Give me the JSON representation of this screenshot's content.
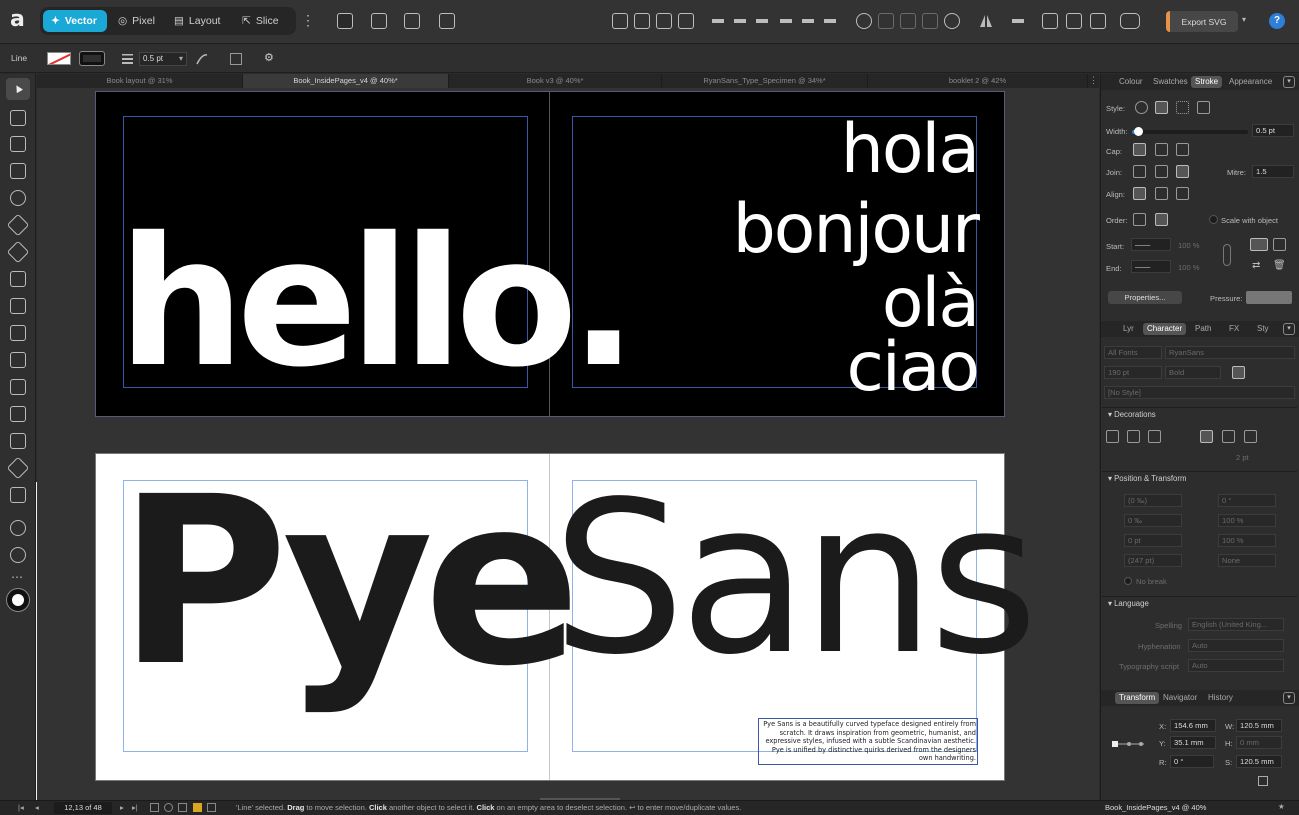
{
  "app": {
    "logo_letter": "a"
  },
  "personas": [
    {
      "label": "Vector",
      "icon": "vector-persona-icon",
      "active": true
    },
    {
      "label": "Pixel",
      "icon": "pixel-persona-icon"
    },
    {
      "label": "Layout",
      "icon": "layout-persona-icon"
    },
    {
      "label": "Slice",
      "icon": "slice-persona-icon"
    }
  ],
  "toolbar": {
    "export_label": "Export SVG",
    "help_label": "?"
  },
  "context": {
    "selection_type": "Line",
    "stroke_width": "0.5 pt"
  },
  "tabs": [
    {
      "label": "Book layout @ 31%"
    },
    {
      "label": "Book_InsidePages_v4 @ 40%*",
      "active": true
    },
    {
      "label": "Book v3 @ 40%*"
    },
    {
      "label": "RyanSans_Type_Specimen @ 34%*"
    },
    {
      "label": "booklet 2 @ 42%"
    }
  ],
  "canvas": {
    "hello_word": "hello.",
    "greetings": [
      "hola",
      "bonjour",
      "olà",
      "ciao"
    ],
    "title_left": "Pye",
    "title_right": "Sans",
    "blurb": "Pye Sans is a beautifully curved typeface designed entirely from scratch. It draws inspiration from geometric, humanist, and expressive styles, infused with a subtle Scandinavian aesthetic. Pye is unified by distinctive quirks derived from the designers own handwriting."
  },
  "stroke_panel": {
    "tabs": [
      "Colour",
      "Swatches",
      "Stroke",
      "Appearance"
    ],
    "style_label": "Style:",
    "width_label": "Width:",
    "width_value": "0.5 pt",
    "width_fraction": 0.05,
    "cap_label": "Cap:",
    "join_label": "Join:",
    "mitre_label": "Mitre:",
    "mitre_value": "1.5",
    "align_label": "Align:",
    "order_label": "Order:",
    "scale_label": "Scale with object",
    "start_label": "Start:",
    "end_label": "End:",
    "start_pct": "100 %",
    "end_pct": "100 %",
    "properties_btn": "Properties...",
    "pressure_label": "Pressure:"
  },
  "character_panel": {
    "tabs": [
      "Lyr",
      "Character",
      "Path",
      "FX",
      "Sty"
    ],
    "font_collection": "All Fonts",
    "font_family": "RyanSans",
    "font_size": "190 pt",
    "font_weight": "Bold",
    "style": "[No Style]",
    "decorations_head": "Decorations",
    "deco_size": "2 pt",
    "position_head": "Position & Transform",
    "pos_values": [
      "(0 ‰)",
      "0 °",
      "0 ‰",
      "100 %",
      "0 pt",
      "100 %",
      "(247 pt)",
      "None"
    ],
    "no_break": "No break",
    "language_head": "Language",
    "spelling_label": "Spelling",
    "spelling_value": "English (United King...",
    "hyphenation_label": "Hyphenation",
    "hyphenation_value": "Auto",
    "script_label": "Typography script",
    "script_value": "Auto"
  },
  "transform_panel": {
    "tabs": [
      "Transform",
      "Navigator",
      "History"
    ],
    "x_label": "X:",
    "x_value": "154.6 mm",
    "y_label": "Y:",
    "y_value": "35.1 mm",
    "w_label": "W:",
    "w_value": "120.5 mm",
    "h_label": "H:",
    "h_value": "0 mm",
    "r_label": "R:",
    "r_value": "0 °",
    "s_label": "S:",
    "s_value": "120.5 mm"
  },
  "status": {
    "page": "12,13 of 48",
    "msg_parts": [
      {
        "text": "'Line' selected. ",
        "bold": false
      },
      {
        "text": "Drag",
        "bold": true
      },
      {
        "text": " to move selection. ",
        "bold": false
      },
      {
        "text": "Click",
        "bold": true
      },
      {
        "text": " another object to select it. ",
        "bold": false
      },
      {
        "text": "Click",
        "bold": true
      },
      {
        "text": " on an empty area to deselect selection. ↩ to enter move/duplicate values.",
        "bold": false
      }
    ],
    "doc": "Book_InsidePages_v4 @ 40%"
  },
  "colors": {
    "accent": "#1aa8d6",
    "export_accent": "#e8934a",
    "margin_guide": "#3a58a8"
  }
}
